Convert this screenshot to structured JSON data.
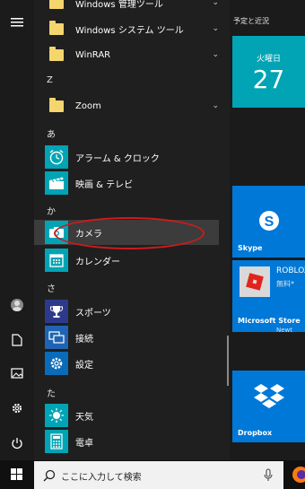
{
  "rail": {
    "items": [
      "menu",
      "user",
      "documents",
      "pictures",
      "settings",
      "power"
    ]
  },
  "applist": {
    "rows": [
      {
        "label": "Windows 管理ツール",
        "expandable": true
      },
      {
        "label": "Windows システム ツール",
        "expandable": true
      },
      {
        "label": "WinRAR",
        "expandable": true
      },
      {
        "letter": "Z"
      },
      {
        "label": "Zoom",
        "expandable": true
      },
      {
        "letter": "あ"
      },
      {
        "label": "アラーム & クロック"
      },
      {
        "label": "映画 & テレビ"
      },
      {
        "letter": "か"
      },
      {
        "label": "カメラ"
      },
      {
        "label": "カレンダー"
      },
      {
        "letter": "さ"
      },
      {
        "label": "スポーツ"
      },
      {
        "label": "接続"
      },
      {
        "label": "設定"
      },
      {
        "letter": "た"
      },
      {
        "label": "天気"
      },
      {
        "label": "電卓"
      }
    ]
  },
  "tiles": {
    "group_title": "予定と近況",
    "calendar": {
      "day_name": "火曜日",
      "day_number": "27"
    },
    "skype": {
      "label": "Skype"
    },
    "store": {
      "title": "ROBLOX",
      "price": "無料*",
      "label": "Microsoft Store",
      "extra": "Newt"
    },
    "dropbox": {
      "label": "Dropbox"
    }
  },
  "taskbar": {
    "search_placeholder": "ここに入力して検索"
  },
  "colors": {
    "accent_teal": "#00a4b4",
    "tile_blue": "#0078d7",
    "folder_yellow": "#f5d56d",
    "annotation_red": "#d11a1a"
  }
}
